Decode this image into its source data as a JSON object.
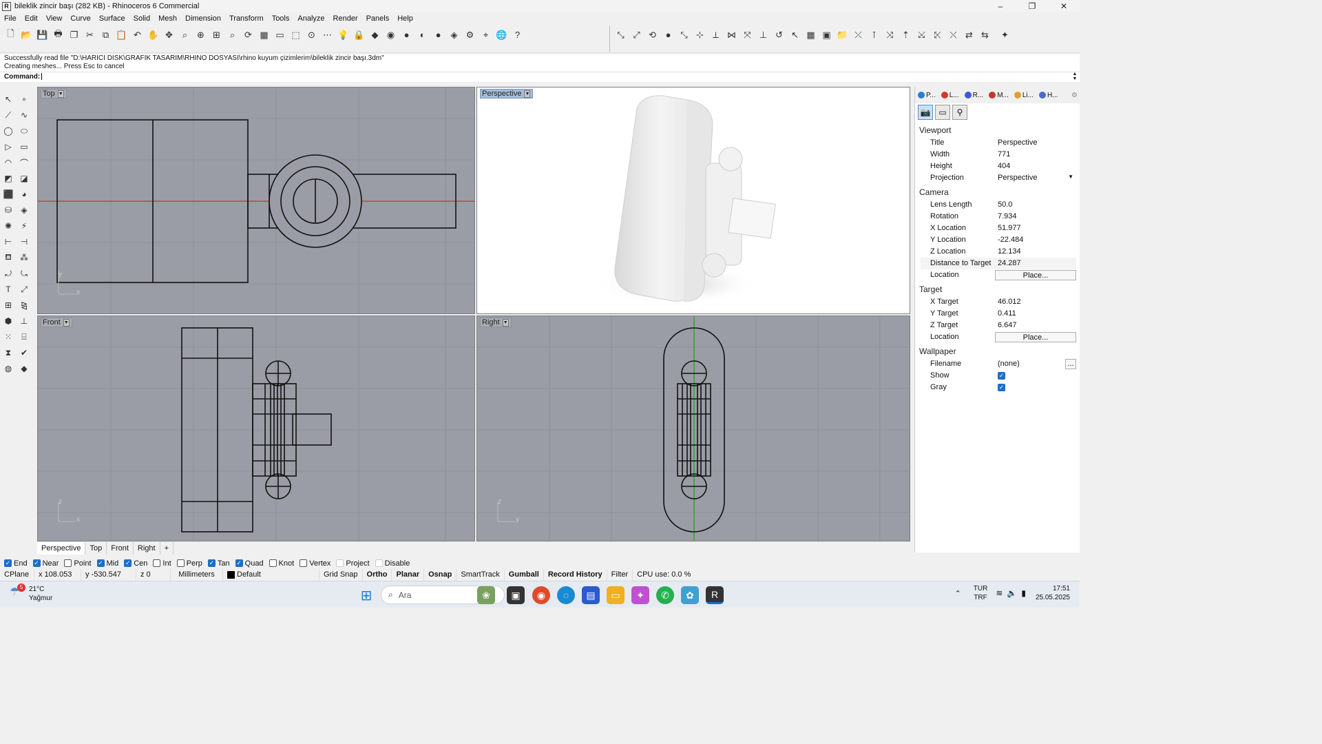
{
  "window": {
    "title": "bileklik zincir başı (282 KB) - Rhinoceros 6 Commercial",
    "app_icon": "R",
    "controls": [
      "–",
      "❐",
      "✕"
    ]
  },
  "menu": [
    "File",
    "Edit",
    "View",
    "Curve",
    "Surface",
    "Solid",
    "Mesh",
    "Dimension",
    "Transform",
    "Tools",
    "Analyze",
    "Render",
    "Panels",
    "Help"
  ],
  "command": {
    "history": [
      "Successfully read file \"D:\\HARICI DISK\\GRAFIK TASARIM\\RHINO DOSYASI\\rhino kuyum çizimlerim\\bileklik zincir başı.3dm\"",
      "Creating meshes... Press Esc to cancel"
    ],
    "prompt": "Command:"
  },
  "viewports": {
    "top": {
      "label": "Top"
    },
    "perspective": {
      "label": "Perspective"
    },
    "front": {
      "label": "Front"
    },
    "right": {
      "label": "Right"
    },
    "axes": {
      "x": "x",
      "y": "y",
      "z": "z"
    }
  },
  "viewport_tabs": [
    "Perspective",
    "Top",
    "Front",
    "Right"
  ],
  "viewport_tab_add": "+",
  "right_panel": {
    "tabs": [
      {
        "label": "P...",
        "color": "#2a7bd4"
      },
      {
        "label": "L...",
        "color": "#d43a2a"
      },
      {
        "label": "R...",
        "color": "#3a5bd4"
      },
      {
        "label": "M...",
        "color": "#c0392b"
      },
      {
        "label": "Li...",
        "color": "#e0a030"
      },
      {
        "label": "H...",
        "color": "#4a6ad0"
      }
    ],
    "sections": {
      "viewport": {
        "title": "Viewport",
        "rows": [
          {
            "k": "Title",
            "v": "Perspective"
          },
          {
            "k": "Width",
            "v": "771"
          },
          {
            "k": "Height",
            "v": "404"
          },
          {
            "k": "Projection",
            "v": "Perspective"
          }
        ]
      },
      "camera": {
        "title": "Camera",
        "rows": [
          {
            "k": "Lens Length",
            "v": "50.0"
          },
          {
            "k": "Rotation",
            "v": "7.934"
          },
          {
            "k": "X Location",
            "v": "51.977"
          },
          {
            "k": "Y Location",
            "v": "-22.484"
          },
          {
            "k": "Z Location",
            "v": "12.134"
          },
          {
            "k": "Distance to Target",
            "v": "24.287"
          },
          {
            "k": "Location",
            "v": "Place..."
          }
        ]
      },
      "target": {
        "title": "Target",
        "rows": [
          {
            "k": "X Target",
            "v": "46.012"
          },
          {
            "k": "Y Target",
            "v": "0.411"
          },
          {
            "k": "Z Target",
            "v": "6.647"
          },
          {
            "k": "Location",
            "v": "Place..."
          }
        ]
      },
      "wallpaper": {
        "title": "Wallpaper",
        "rows": [
          {
            "k": "Filename",
            "v": "(none)",
            "btn": "..."
          },
          {
            "k": "Show",
            "checked": true
          },
          {
            "k": "Gray",
            "checked": true
          }
        ]
      }
    }
  },
  "osnap": [
    {
      "label": "End",
      "on": true
    },
    {
      "label": "Near",
      "on": true
    },
    {
      "label": "Point",
      "on": false
    },
    {
      "label": "Mid",
      "on": true
    },
    {
      "label": "Cen",
      "on": true
    },
    {
      "label": "Int",
      "on": false
    },
    {
      "label": "Perp",
      "on": false
    },
    {
      "label": "Tan",
      "on": true
    },
    {
      "label": "Quad",
      "on": true
    },
    {
      "label": "Knot",
      "on": false
    },
    {
      "label": "Vertex",
      "on": false
    },
    {
      "label": "Project",
      "on": false
    },
    {
      "label": "Disable",
      "on": false
    }
  ],
  "status": {
    "cplane": "CPlane",
    "x": "x 108.053",
    "y": "y -530.547",
    "z": "z 0",
    "units": "Millimeters",
    "layer": "Default",
    "grid_snap": "Grid Snap",
    "ortho": "Ortho",
    "planar": "Planar",
    "osnap": "Osnap",
    "smarttrack": "SmartTrack",
    "gumball": "Gumball",
    "record_history": "Record History",
    "filter": "Filter",
    "cpu": "CPU use: 0.0 %"
  },
  "taskbar": {
    "weather_temp": "21°C",
    "weather_desc": "Yağmur",
    "weather_badge": "5",
    "search_placeholder": "Ara",
    "lang_top": "TUR",
    "lang_bottom": "TRF",
    "time": "17:51",
    "date": "25.05.2025"
  },
  "colors": {
    "viewport_bg": "#9a9da5",
    "active_label": "#a6bdd8",
    "x_axis": "#c02020",
    "y_axis": "#20a020",
    "accent": "#1a6fc9"
  }
}
